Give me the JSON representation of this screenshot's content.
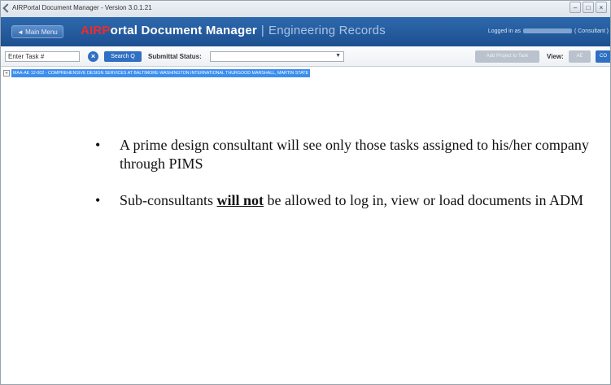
{
  "window": {
    "title": "AIRPortal Document Manager - Version 3.0.1.21",
    "controls": [
      "–",
      "□",
      "×"
    ]
  },
  "header": {
    "main_menu_label": "◄ Main Menu",
    "title_brand": "AIRP",
    "title_main": "ortal Document Manager",
    "title_divider": "|",
    "title_sub": "Engineering Records",
    "logged_in_prefix": "Logged in as",
    "logged_in_role": "( Consultant )"
  },
  "toolbar": {
    "task_input_value": "Enter Task #",
    "clear_icon": "×",
    "search_label": "Search Q",
    "submittal_status_label": "Submittal Status:",
    "submittal_status_value": "",
    "select_arrow": "▼",
    "add_project_label": "Add Project to Task",
    "view_label": "View:",
    "view_ae_label": "AE",
    "view_co_label": "CO"
  },
  "tree": {
    "expander": "+",
    "item_label": "MAA-AE 12-002 - COMPREHENSIVE DESIGN SERVICES AT BALTIMORE-WASHINGTON INTERNATIONAL THURGOOD MARSHALL, MARTIN STATE"
  },
  "content": {
    "bullet_char": "•",
    "bullet1_text": "A prime design consultant will see only those tasks assigned to his/her company through PIMS",
    "bullet2_before": "Sub-consultants ",
    "bullet2_strong": "will not",
    "bullet2_after": " be allowed to log in, view or load documents in ADM"
  },
  "colors": {
    "header_blue": "#1c4f90",
    "brand_red": "#ee2b2b",
    "button_blue": "#2f6fc4",
    "tree_highlight": "#3b8ef0"
  }
}
